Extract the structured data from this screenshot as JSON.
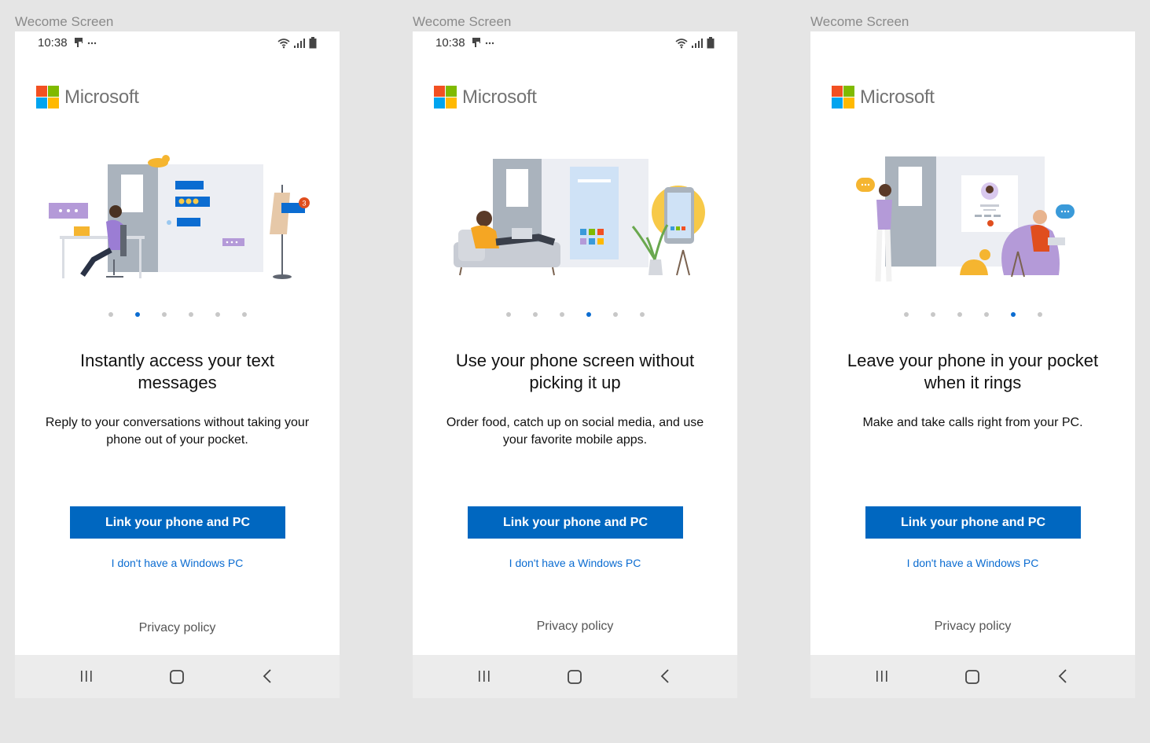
{
  "colors": {
    "accent": "#0067c0",
    "link": "#0b6cd1",
    "ms_red": "#f25022",
    "ms_green": "#7fba00",
    "ms_blue": "#00a4ef",
    "ms_yellow": "#ffb900"
  },
  "screens": [
    {
      "frame_label": "Wecome Screen",
      "status": {
        "time": "10:38",
        "notif": "⬚ ···"
      },
      "brand": "Microsoft",
      "illustration": "illustration-woman-laptop-messages",
      "active_dot": 2,
      "dot_count": 6,
      "title": "Instantly access your text messages",
      "description": "Reply to your conversations without taking your phone out of your pocket.",
      "primary_button": "Link your phone and PC",
      "secondary_link": "I don't have a Windows PC",
      "privacy": "Privacy policy"
    },
    {
      "frame_label": "Wecome Screen",
      "status": {
        "time": "10:38",
        "notif": "⬚ ···"
      },
      "brand": "Microsoft",
      "illustration": "illustration-man-couch-phone-apps",
      "active_dot": 4,
      "dot_count": 6,
      "title": "Use your phone screen without picking it up",
      "description": "Order food, catch up on social media, and use your favorite mobile apps.",
      "primary_button": "Link your phone and PC",
      "secondary_link": "I don't have a Windows PC",
      "privacy": "Privacy policy"
    },
    {
      "frame_label": "Wecome Screen",
      "status": null,
      "brand": "Microsoft",
      "illustration": "illustration-people-calls",
      "active_dot": 5,
      "dot_count": 6,
      "title": "Leave your phone in your pocket when it rings",
      "description": "Make and take calls right from your PC.",
      "primary_button": "Link your phone and PC",
      "secondary_link": "I don't have a Windows PC",
      "privacy": "Privacy policy"
    }
  ],
  "navbar": {
    "icons": [
      "recents-icon",
      "home-icon",
      "back-icon"
    ]
  }
}
